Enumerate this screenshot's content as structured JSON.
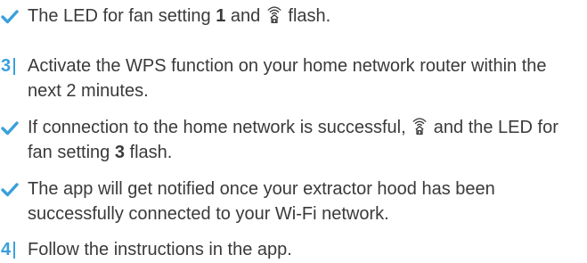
{
  "colors": {
    "accent": "#3aa0db",
    "text": "#3a3a3a"
  },
  "items": [
    {
      "kind": "check",
      "pre": "The LED for fan setting ",
      "bold": "1",
      "mid": " and ",
      "icon": "wifi-home-icon",
      "post": " flash."
    },
    {
      "kind": "step",
      "number": "3",
      "text": "Activate the WPS function on your home network router within the next 2 minutes."
    },
    {
      "kind": "check",
      "pre": "If connection to the home network is successful, ",
      "icon": "wifi-home-icon",
      "mid": " and the LED for fan setting ",
      "bold": "3",
      "post": " flash."
    },
    {
      "kind": "check",
      "text": "The app will get notified once your extractor hood has been successfully connected to your Wi-Fi network."
    },
    {
      "kind": "step",
      "number": "4",
      "text": "Follow the instructions in the app."
    }
  ]
}
